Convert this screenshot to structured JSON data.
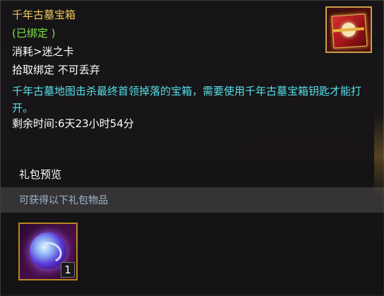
{
  "tooltip": {
    "title": "千年古墓宝箱",
    "bound_status": "(已绑定 )",
    "consume_line": "消耗>迷之卡",
    "pickup_line": "拾取绑定 不可丢弃",
    "description": "千年古墓地图击杀最终首领掉落的宝箱，需要使用千年古墓宝箱钥匙才能打开。",
    "remaining_time": "剩余时间:6天23小时54分",
    "item_icon": "treasure-chest-icon"
  },
  "gift_preview": {
    "header": "礼包预览",
    "subheader": "可获得以下礼包物品",
    "items": [
      {
        "icon": "magic-orb-icon",
        "count": "1"
      }
    ]
  },
  "colors": {
    "title": "#f1c75b",
    "bound": "#7fe04a",
    "description": "#55e0ea",
    "slot_border": "#b8881e"
  }
}
